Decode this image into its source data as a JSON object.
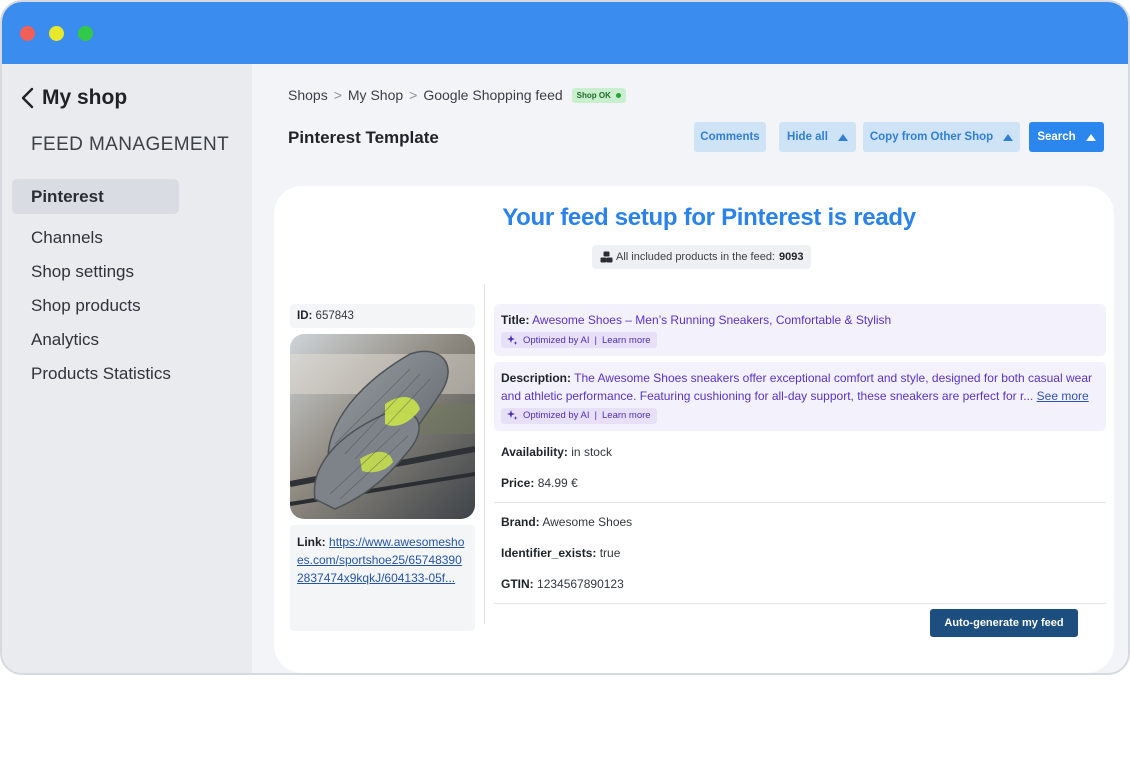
{
  "window": {
    "controls": {
      "close_color": "#f25f58",
      "minimize_color": "#e8e82a",
      "zoom_color": "#32c94a"
    }
  },
  "sidebar": {
    "back_label": "My shop",
    "section_title": "FEED MANAGEMENT",
    "active_item": "Pinterest",
    "items": [
      {
        "label": "Channels"
      },
      {
        "label": "Shop settings"
      },
      {
        "label": "Shop products"
      },
      {
        "label": "Analytics"
      },
      {
        "label": "Products Statistics"
      }
    ]
  },
  "breadcrumb": {
    "items": [
      "Shops",
      "My Shop",
      "Google Shopping feed"
    ],
    "badge": "Shop OK"
  },
  "header": {
    "title": "Pinterest Template",
    "buttons": {
      "comments": "Comments",
      "hide_all": "Hide all",
      "copy_from": "Copy from Other Shop",
      "search": "Search"
    }
  },
  "card": {
    "title": "Your feed setup for Pinterest is ready",
    "count_label": "All included products in the feed:",
    "count_value": "9093",
    "product": {
      "id_label": "ID:",
      "id_value": "657843",
      "link_label": "Link:",
      "link_value": "https://www.awesomeshoes.com/sportshoe25/657483902837474x9kqkJ/604133-05f..."
    },
    "fields": {
      "title_label": "Title:",
      "title_value": "Awesome Shoes – Men’s Running Sneakers, Comfortable & Stylish",
      "description_label": "Description:",
      "description_value": "The Awesome Shoes sneakers offer exceptional comfort and style, designed for both casual wear and athletic performance. Featuring cushioning for all-day support, these sneakers are perfect for r...",
      "see_more": "See more",
      "ai_tag": "Optimized by AI",
      "learn_more": "Learn more",
      "availability_label": "Availability:",
      "availability_value": "in stock",
      "price_label": "Price:",
      "price_value": "84.99 €",
      "brand_label": "Brand:",
      "brand_value": "Awesome Shoes",
      "identifier_label": "Identifier_exists:",
      "identifier_value": "true",
      "gtin_label": "GTIN:",
      "gtin_value": "1234567890123"
    },
    "generate_button": "Auto-generate my feed"
  }
}
